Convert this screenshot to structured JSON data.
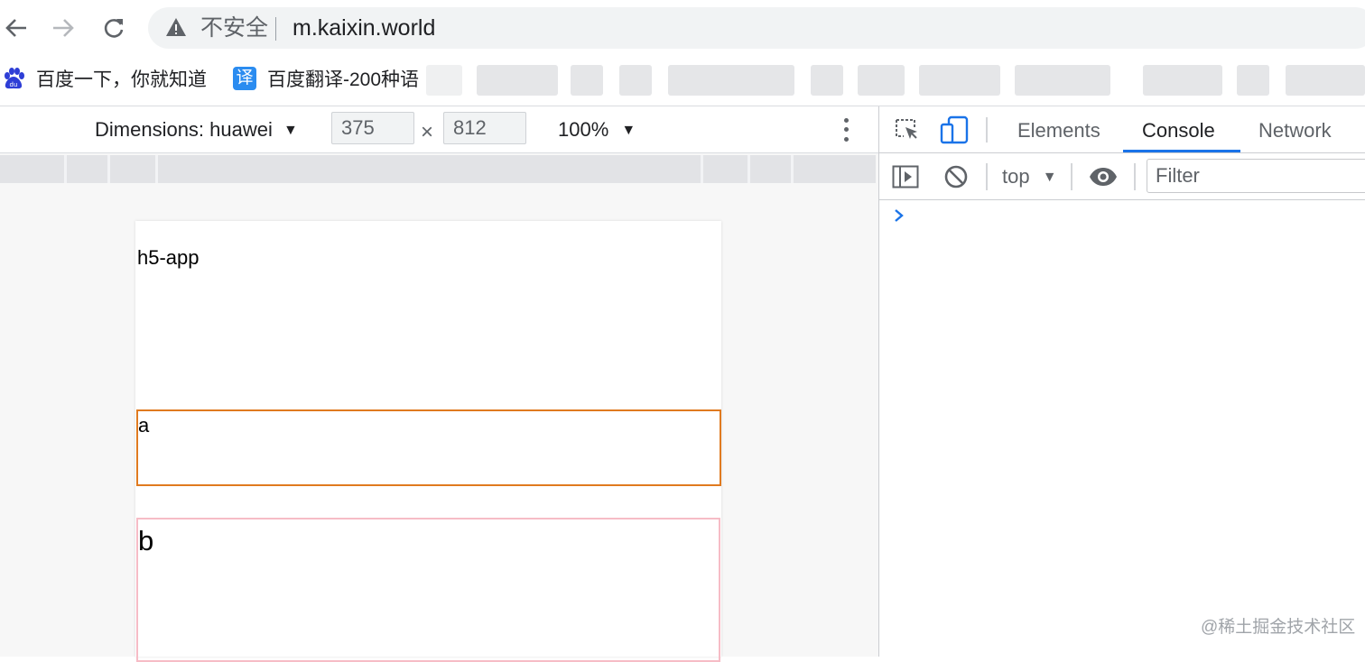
{
  "browser": {
    "security_label": "不安全",
    "url": "m.kaixin.world",
    "bookmarks": [
      {
        "label": "百度一下，你就知道",
        "icon": "baidu-paw-icon"
      },
      {
        "label": "百度翻译-200种语",
        "icon": "translate-icon",
        "icon_glyph": "译"
      }
    ]
  },
  "device_toolbar": {
    "dimensions_label": "Dimensions: huawei",
    "width": "375",
    "height": "812",
    "times": "×",
    "zoom": "100%"
  },
  "page": {
    "app_title": "h5-app",
    "box_a": "a",
    "box_b": "b",
    "colors": {
      "box_a_border": "#e07a1f",
      "box_b_border": "#f6bcc6"
    }
  },
  "devtools": {
    "tabs": [
      "Elements",
      "Console",
      "Network"
    ],
    "active_tab": "Console",
    "context": "top",
    "filter_placeholder": "Filter",
    "accent": "#1a73e8"
  },
  "watermark": "@稀土掘金技术社区"
}
